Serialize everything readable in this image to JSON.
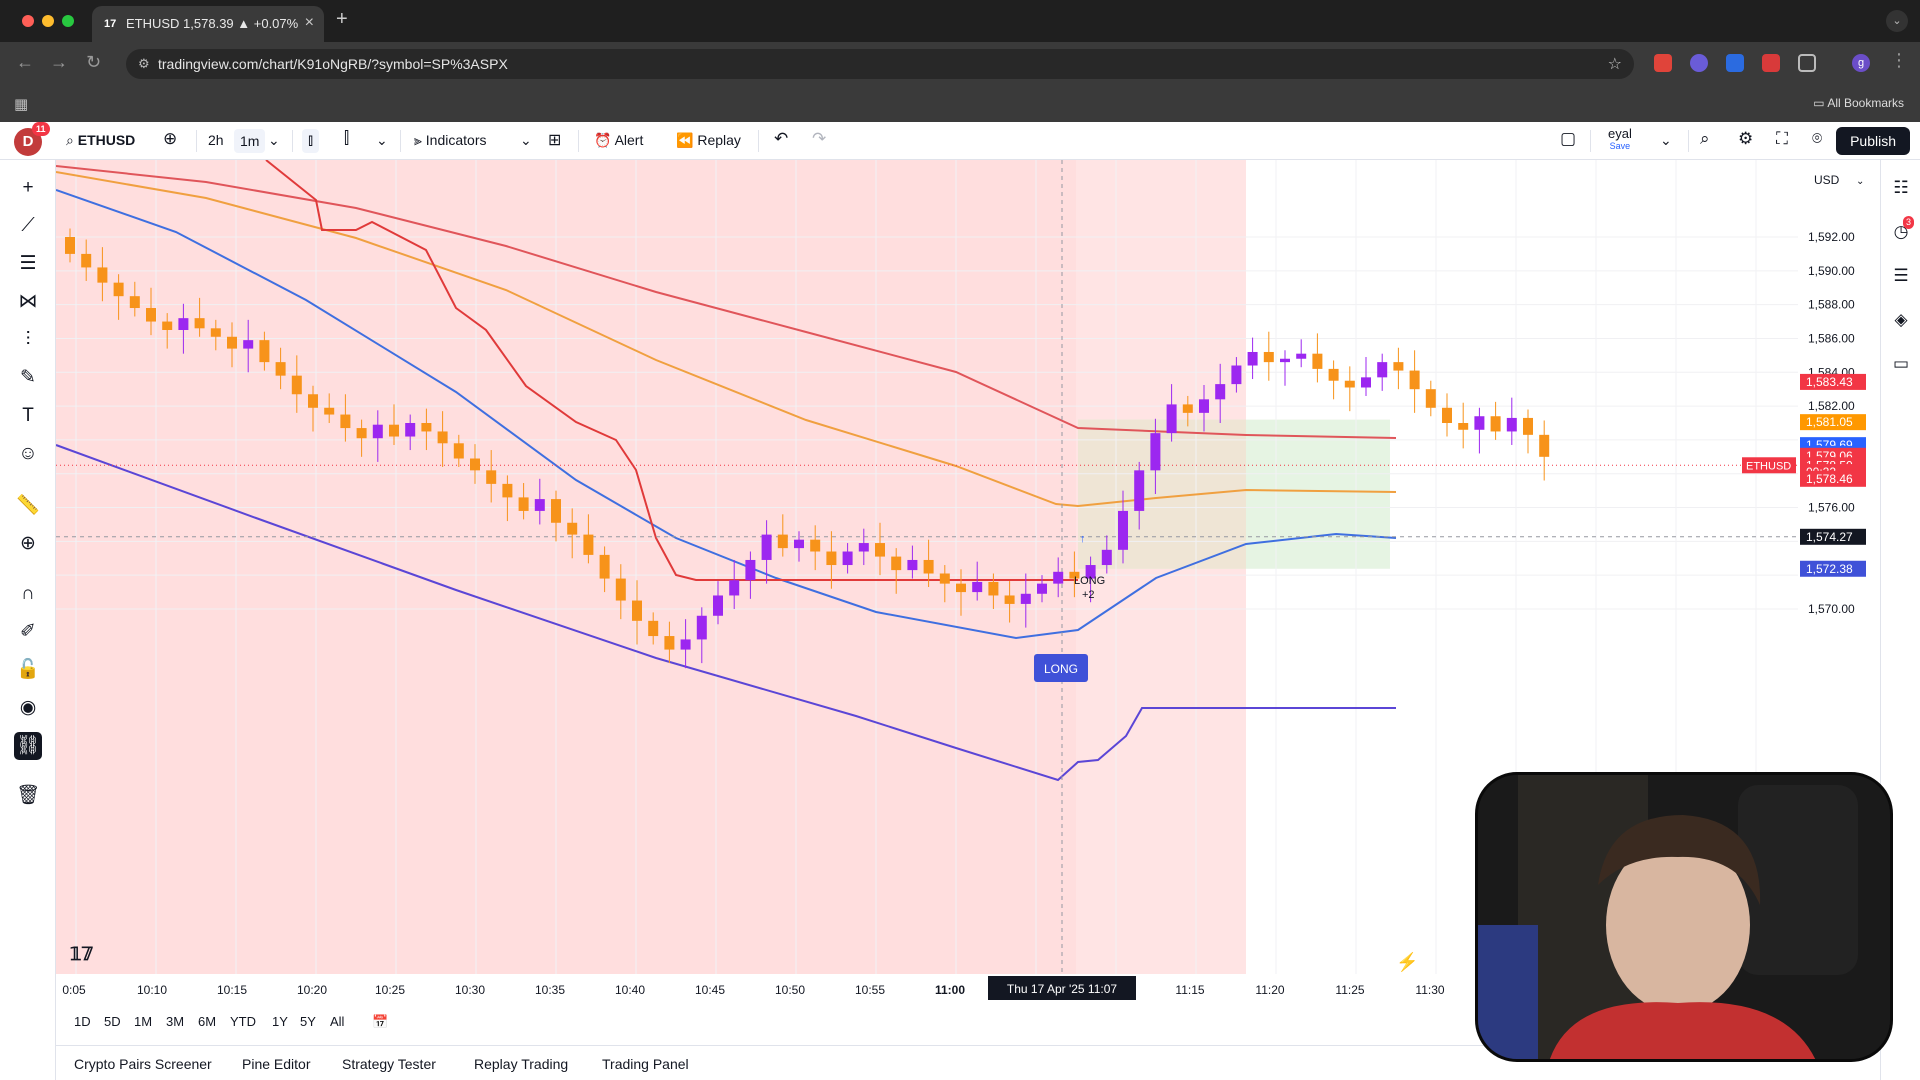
{
  "browser": {
    "tab_title": "ETHUSD 1,578.39 ▲ +0.07%",
    "tab_favicon": "17",
    "url": "tradingview.com/chart/K91oNgRB/?symbol=SP%3ASPX",
    "all_bookmarks": "All Bookmarks",
    "profile_initial": "g"
  },
  "toolbar": {
    "avatar_letter": "D",
    "avatar_badge": "11",
    "symbol": "ETHUSD",
    "interval_fav1": "2h",
    "interval_fav2": "1m",
    "indicators": "Indicators",
    "alert": "Alert",
    "replay": "Replay",
    "layout_name": "eyal",
    "layout_sub": "Save",
    "publish": "Publish"
  },
  "chart": {
    "currency": "USD",
    "symbol_tag": "ETHUSD",
    "price_ticks": [
      "1,592.00",
      "1,590.00",
      "1,588.00",
      "1,586.00",
      "1,584.00",
      "1,582.00",
      "1,576.00",
      "1,570.00"
    ],
    "price_ticks_values": [
      1592,
      1590,
      1588,
      1586,
      1584,
      1582,
      1576,
      1570
    ],
    "time_ticks": [
      "0:05",
      "10:10",
      "10:15",
      "10:20",
      "10:25",
      "10:30",
      "10:35",
      "10:40",
      "10:45",
      "10:50",
      "10:55",
      "11:00",
      "11:15",
      "11:20",
      "11:25",
      "11:30"
    ],
    "crosshair_time": "Thu 17 Apr '25   11:07",
    "price_labels": [
      {
        "text": "1,583.43",
        "color": "#f23645",
        "price": 1583.43
      },
      {
        "text": "1,581.05",
        "color": "#ff9800",
        "price": 1581.05
      },
      {
        "text": "1,579.69",
        "color": "#2962ff",
        "price": 1579.69
      },
      {
        "text": "1,579.18",
        "color": "#2962ff",
        "price": 1579.18
      },
      {
        "text": "1,579.06",
        "color": "#f23645",
        "price": 1579.06
      },
      {
        "text": "1,578.50",
        "color": "#f23645",
        "price": 1578.5
      },
      {
        "text": "00:22",
        "color": "#f23645",
        "price": 1578.1
      },
      {
        "text": "1,578.46",
        "color": "#f23645",
        "price": 1577.7
      },
      {
        "text": "1,574.27",
        "color": "#131722",
        "price": 1574.27
      },
      {
        "text": "1,572.38",
        "color": "#3f51d8",
        "price": 1572.38
      }
    ],
    "long_label": "LONG",
    "long_sub": "+2",
    "long_box": "LONG",
    "ranges": [
      "1D",
      "5D",
      "1M",
      "3M",
      "6M",
      "YTD",
      "1Y",
      "5Y",
      "All"
    ]
  },
  "bottom_tabs": [
    "Crypto Pairs Screener",
    "Pine Editor",
    "Strategy Tester",
    "Replay Trading",
    "Trading Panel"
  ],
  "colors": {
    "up": "#9c27f0",
    "down": "#f7931a",
    "ema_red": "#e0555a",
    "ema_orange": "#f0a040",
    "ema_blue": "#3f6fe0",
    "line_purple": "#5b46d6",
    "stop_red": "#e03a3a"
  }
}
